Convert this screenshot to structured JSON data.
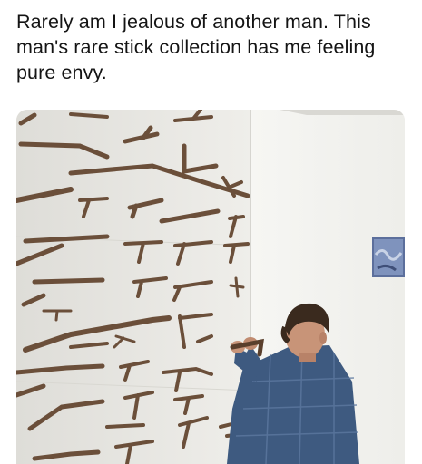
{
  "post": {
    "caption": "Rarely am I jealous of another man. This man's rare stick collection has me feeling pure envy.",
    "photo": {
      "subject": "man mounting sticks on a wall",
      "colors": {
        "wall_left": "#e9e8e4",
        "wall_right": "#f4f4f1",
        "stick": "#6b4f3a",
        "shirt": "#3e5a80",
        "hair": "#3a2a1e"
      }
    }
  }
}
